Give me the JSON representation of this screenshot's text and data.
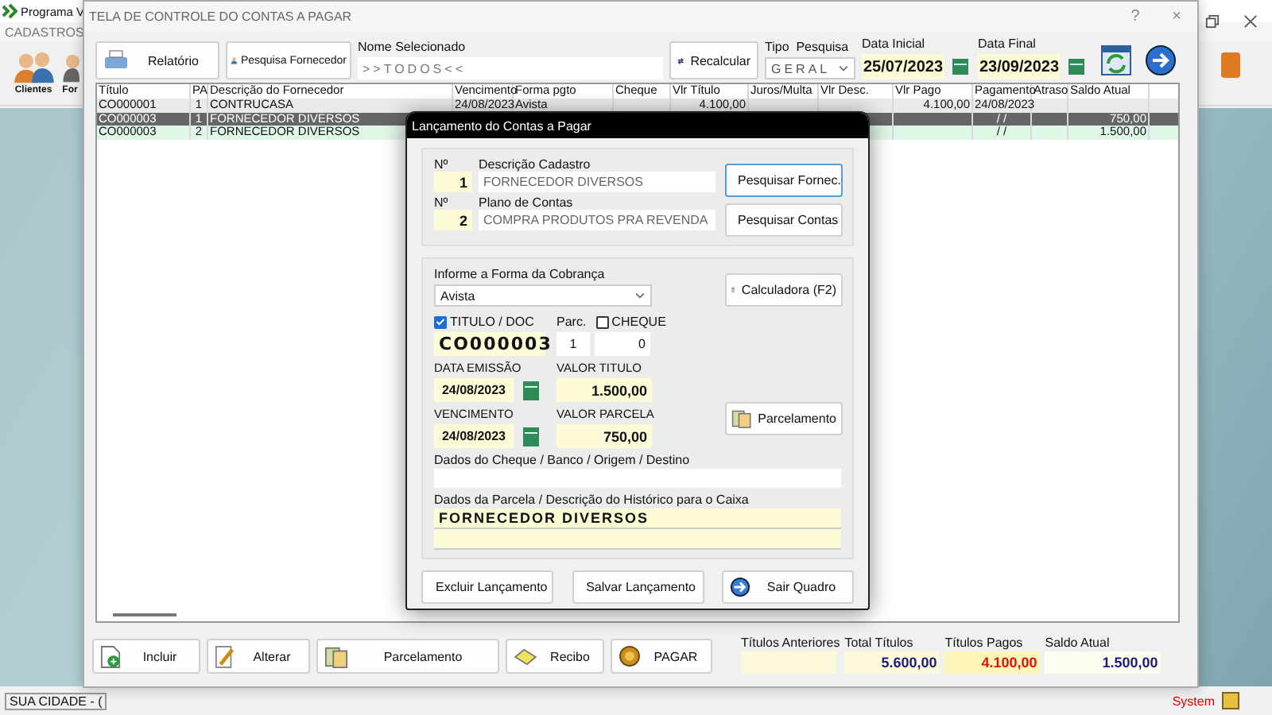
{
  "app": {
    "title": "Programa V",
    "menu": [
      "CADASTROS"
    ],
    "toolbar": [
      {
        "kind": "clients",
        "label": "Clientes"
      },
      {
        "kind": "suppliers",
        "label": "For"
      }
    ],
    "status_left": "SUA CIDADE - (",
    "status_right": "System"
  },
  "window": {
    "title": "TELA DE CONTROLE DO CONTAS A PAGAR",
    "help": "?",
    "close": "×"
  },
  "toolbar": {
    "report_button": "Relatório",
    "supplier_button": "Pesquisa Fornecedor",
    "name_label": "Nome Selecionado",
    "name_value": ">>TODOS<<",
    "recalc_button": "Recalcular",
    "search_type_label": "Tipo  Pesquisa",
    "search_type": "GERAL",
    "start_label": "Data Inicial",
    "start_date": "25/07/2023",
    "end_label": "Data Final",
    "end_date": "23/09/2023"
  },
  "table": {
    "columns": [
      "Título",
      "PA",
      "Descrição do Fornecedor",
      "Vencimento",
      "Forma pgto",
      "Cheque",
      "Vlr Título",
      "Juros/Multa",
      "Vlr Desc.",
      "Vlr Pago",
      "Pagamento",
      "Atraso",
      "Saldo Atual"
    ],
    "rows": [
      {
        "selected": false,
        "highlighted": false,
        "cells": [
          "CO000001",
          "1",
          "CONTRUCASA",
          "24/08/2023",
          "Avista",
          null,
          "4.100,00",
          null,
          null,
          "4.100,00",
          "24/08/2023",
          null,
          null
        ]
      },
      {
        "selected": true,
        "highlighted": false,
        "cells": [
          "CO000003",
          "1",
          "FORNECEDOR DIVERSOS",
          null,
          null,
          null,
          null,
          null,
          null,
          null,
          "/ /",
          null,
          "750,00"
        ]
      },
      {
        "selected": false,
        "highlighted": true,
        "cells": [
          "CO000003",
          "2",
          "FORNECEDOR DIVERSOS",
          null,
          null,
          null,
          null,
          null,
          null,
          null,
          "/ /",
          null,
          "1.500,00"
        ]
      }
    ]
  },
  "actions": [
    {
      "kind": "add",
      "label": "Incluir"
    },
    {
      "kind": "edit",
      "label": "Alterar"
    },
    {
      "kind": "installments",
      "label": "Parcelamento"
    },
    {
      "kind": "receipt",
      "label": "Recibo"
    },
    {
      "kind": "pay",
      "label": "PAGAR"
    }
  ],
  "totals": [
    {
      "label": "Títulos Anteriores"
    },
    {
      "label": "Total Títulos",
      "value": "5.600,00",
      "color": "#1a1a80"
    },
    {
      "label": "Títulos Pagos",
      "value": "4.100,00",
      "color": "#e01010"
    },
    {
      "label": "Saldo Atual",
      "value": "1.500,00",
      "color": "#1a1a80"
    }
  ],
  "dialog": {
    "title": "Lançamento do Contas a Pagar",
    "entries": [
      {
        "number_label": "Nº",
        "number": "1",
        "label": "Descrição Cadastro",
        "value": "FORNECEDOR DIVERSOS"
      },
      {
        "number_label": "Nº",
        "number": "2",
        "label": "Plano de Contas",
        "value": "COMPRA PRODUTOS PRA REVENDA"
      }
    ],
    "search_supplier_button": "Pesquisar Fornec.",
    "search_accounts_button": "Pesquisar Contas",
    "payment_label": "Informe a Forma da Cobrança",
    "payment_method": "Avista",
    "doc_checkbox": {
      "label": "TITULO / DOC",
      "checked": true
    },
    "parc_label": "Parc.",
    "cheque_checkbox": {
      "label": "CHEQUE",
      "checked": false
    },
    "doc_number": "CO000003",
    "parc": "1",
    "cheque_value": "0",
    "issue_label": "DATA EMISSÃO",
    "issue_date": "24/08/2023",
    "title_value_label": "VALOR TITULO",
    "title_value": "1.500,00",
    "due_label": "VENCIMENTO",
    "due_date": "24/08/2023",
    "installment_value_label": "VALOR PARCELA",
    "installment_value": "750,00",
    "calculator_button": "Calculadora (F2)",
    "installments_button": "Parcelamento",
    "cheque_data_label": "Dados do Cheque / Banco / Origem / Destino",
    "history_label": "Dados da Parcela / Descrição do Histórico para o Caixa",
    "history": "FORNECEDOR DIVERSOS",
    "buttons": [
      {
        "kind": "delete",
        "label": "Excluir Lançamento"
      },
      {
        "kind": "save",
        "label": "Salvar Lançamento"
      },
      {
        "kind": "exit",
        "label": "Sair Quadro"
      }
    ]
  }
}
